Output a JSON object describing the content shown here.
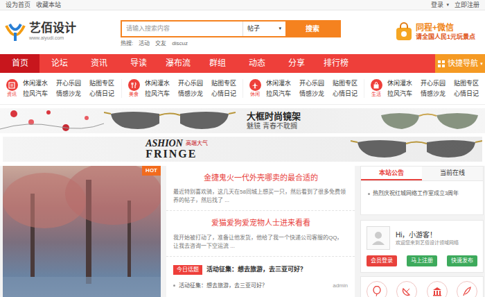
{
  "topbar": {
    "left": [
      "设为首页",
      "收藏本站"
    ],
    "login": "登录",
    "login_arrow": "▾",
    "register": "立即注册"
  },
  "logo": {
    "name": "艺佰设计",
    "url": "www.aiyudi.com"
  },
  "search": {
    "placeholder": "请输入搜索内容",
    "type": "帖子",
    "type_arrow": "▾",
    "button": "搜索",
    "hot_label": "热搜:",
    "hot": [
      "活动",
      "交友",
      "discuz"
    ]
  },
  "header_ad": {
    "line1": "同程+微信",
    "line2": "请全国人民1元玩景点"
  },
  "nav": {
    "items": [
      {
        "label": "首页",
        "selected": true
      },
      {
        "label": "论坛",
        "selected": false
      },
      {
        "label": "资讯",
        "selected": false
      },
      {
        "label": "导读",
        "selected": false
      },
      {
        "label": "瀑布流",
        "selected": false
      },
      {
        "label": "群组",
        "selected": false
      },
      {
        "label": "动态",
        "selected": false
      },
      {
        "label": "分享",
        "selected": false
      },
      {
        "label": "排行榜",
        "selected": false
      }
    ],
    "quick": "快捷导航",
    "quick_arrow": "▾"
  },
  "categories": [
    {
      "label": "资讯",
      "links": [
        "休闲灌水",
        "开心乐园",
        "贴图专区",
        "拉风汽车",
        "情感沙龙",
        "心情日记"
      ]
    },
    {
      "label": "美食",
      "links": [
        "休闲灌水",
        "开心乐园",
        "贴图专区",
        "拉风汽车",
        "情感沙龙",
        "心情日记"
      ]
    },
    {
      "label": "休闲",
      "links": [
        "休闲灌水",
        "开心乐园",
        "贴图专区",
        "拉风汽车",
        "情感沙龙",
        "心情日记"
      ]
    },
    {
      "label": "生活",
      "links": [
        "休闲灌水",
        "开心乐园",
        "贴图专区",
        "拉风汽车",
        "情感沙龙",
        "心情日记"
      ]
    }
  ],
  "banners": {
    "first": {
      "title": "大框时尚镜架",
      "subtitle": "魅镜 青春不耽搁"
    },
    "second": {
      "line1": "ASHION",
      "tag": "高端大气",
      "line2": "FRINGE"
    }
  },
  "feature": {
    "badge": "HOT"
  },
  "articles": [
    {
      "title": "金捷鬼火一代外壳哪卖的最合适的",
      "summary": "最近特别喜欢骑，这几天在58同城上想买一只，然后看到了很多免费领养的帖子，然后找了 ..."
    },
    {
      "title": "爱猫爱狗爱宠物人士进来看看",
      "summary": "我开始被打动了，准备让他发货，他给了我一个快递公司客服的QQ，让我去咨询一下空运流 ..."
    }
  ],
  "topic": {
    "badge": "今日话题",
    "title": "活动征集：想去旅游，去三亚可好？"
  },
  "threads": [
    {
      "title": "活动征集：想去旅游，去三亚可好？",
      "author": "admin"
    }
  ],
  "sidebar": {
    "tabs": [
      {
        "label": "本站公告",
        "selected": true
      },
      {
        "label": "当前在线",
        "selected": false
      }
    ],
    "notices": [
      "热烈庆祝红城网络工作室成立3周年"
    ],
    "greeting": "Hi，小游客！",
    "welcome": "欢迎您来到艺佰设计领域网络",
    "buttons": [
      {
        "label": "会员登录",
        "color": "#e8413c"
      },
      {
        "label": "马上注册",
        "color": "#3daa5c"
      },
      {
        "label": "快速发布",
        "color": "#3daa5c"
      }
    ]
  }
}
